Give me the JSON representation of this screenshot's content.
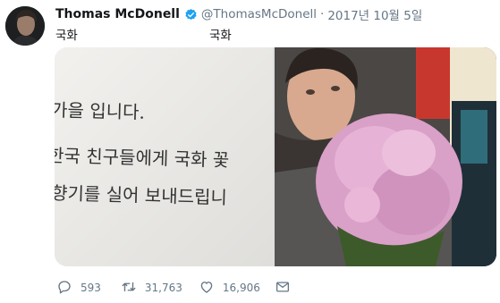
{
  "tweet": {
    "author_name": "Thomas McDonell",
    "handle": "@ThomasMcDonell",
    "separator": "·",
    "date": "2017년 10월 5일",
    "text": "국화",
    "translation": "국화"
  },
  "handwriting": {
    "line1": "가을 입니다.",
    "line2": "한국 친구들에게 국화 꽃",
    "line3": "향기를 실어 보내드립니"
  },
  "actions": {
    "replies": "593",
    "retweets": "31,763",
    "likes": "16,906"
  },
  "icons": {
    "verified": "verified-badge-icon",
    "reply": "reply-icon",
    "retweet": "retweet-icon",
    "like": "heart-icon",
    "message": "envelope-icon"
  },
  "colors": {
    "verified": "#1da1f2",
    "text": "#14171a",
    "muted": "#657786",
    "flowers": "#e2a6cf"
  }
}
